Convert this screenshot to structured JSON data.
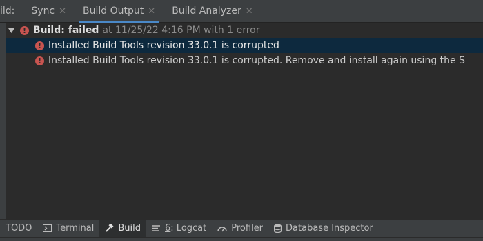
{
  "tabs_header": {
    "prefix": "ild:",
    "tabs": [
      {
        "label": "Sync",
        "active": false
      },
      {
        "label": "Build Output",
        "active": true
      },
      {
        "label": "Build Analyzer",
        "active": false
      }
    ]
  },
  "build": {
    "title": "Build:",
    "status": "failed",
    "meta": "at 11/25/22 4:16 PM with 1 error",
    "errors": [
      {
        "text": "Installed Build Tools revision 33.0.1 is corrupted",
        "selected": true
      },
      {
        "text": "Installed Build Tools revision 33.0.1 is corrupted. Remove and install again using the S",
        "selected": false
      }
    ]
  },
  "tool_windows": [
    {
      "label": "TODO",
      "icon": "none",
      "active": false
    },
    {
      "label": "Terminal",
      "icon": "terminal-icon",
      "active": false
    },
    {
      "label": "Build",
      "icon": "hammer-icon",
      "active": true
    },
    {
      "number": "6",
      "label": ": Logcat",
      "icon": "logcat-icon",
      "active": false
    },
    {
      "label": "Profiler",
      "icon": "gauge-icon",
      "active": false
    },
    {
      "label": "Database Inspector",
      "icon": "database-icon",
      "active": false
    }
  ],
  "colors": {
    "error": "#c75450",
    "selection": "#0d293e",
    "accent": "#4a88c7"
  }
}
